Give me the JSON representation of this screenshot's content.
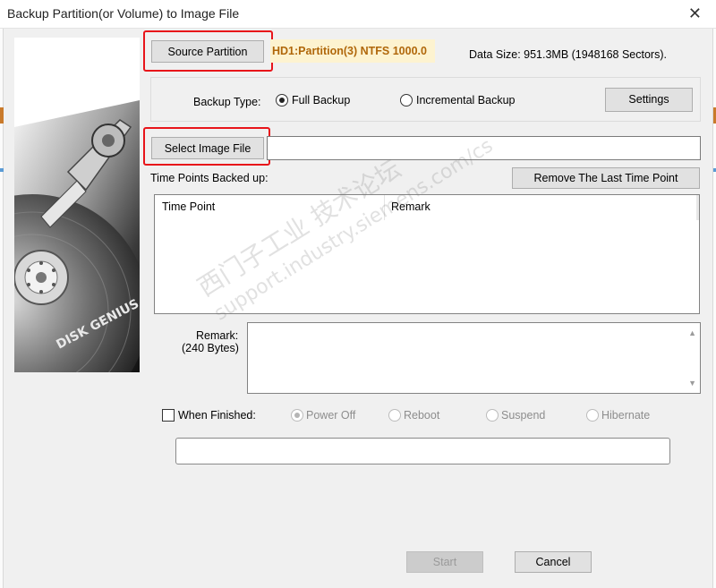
{
  "window": {
    "title": "Backup Partition(or Volume) to Image File",
    "close_glyph": "✕"
  },
  "source": {
    "button_label": "Source Partition",
    "partition_text": "HD1:Partition(3) NTFS 1000.0",
    "data_size": "Data Size: 951.3MB (1948168 Sectors)."
  },
  "backup_type": {
    "label": "Backup Type:",
    "options": [
      {
        "label": "Full Backup",
        "checked": true
      },
      {
        "label": "Incremental Backup",
        "checked": false
      }
    ],
    "settings_label": "Settings"
  },
  "image_file": {
    "button_label": "Select Image File",
    "value": ""
  },
  "time_points": {
    "label": "Time Points Backed up:",
    "remove_label": "Remove The Last Time Point",
    "columns": [
      "Time Point",
      "Remark"
    ],
    "rows": []
  },
  "remark": {
    "label": "Remark:",
    "sublabel": "(240 Bytes)",
    "value": ""
  },
  "when_finished": {
    "label": "When Finished:",
    "checked": false,
    "options": [
      {
        "label": "Power Off",
        "checked": true
      },
      {
        "label": "Reboot",
        "checked": false
      },
      {
        "label": "Suspend",
        "checked": false
      },
      {
        "label": "Hibernate",
        "checked": false
      }
    ]
  },
  "actions": {
    "start_label": "Start",
    "cancel_label": "Cancel"
  },
  "image_panel": {
    "logo_text": "DISK GENIUS"
  },
  "watermark": {
    "line1": "西门子工业 技术论坛",
    "line2": "support.industry.siemens.com/cs"
  },
  "colors": {
    "highlight_red": "#e8141a",
    "partition_text": "#b0670a",
    "partition_bg": "#fdf3d0"
  }
}
